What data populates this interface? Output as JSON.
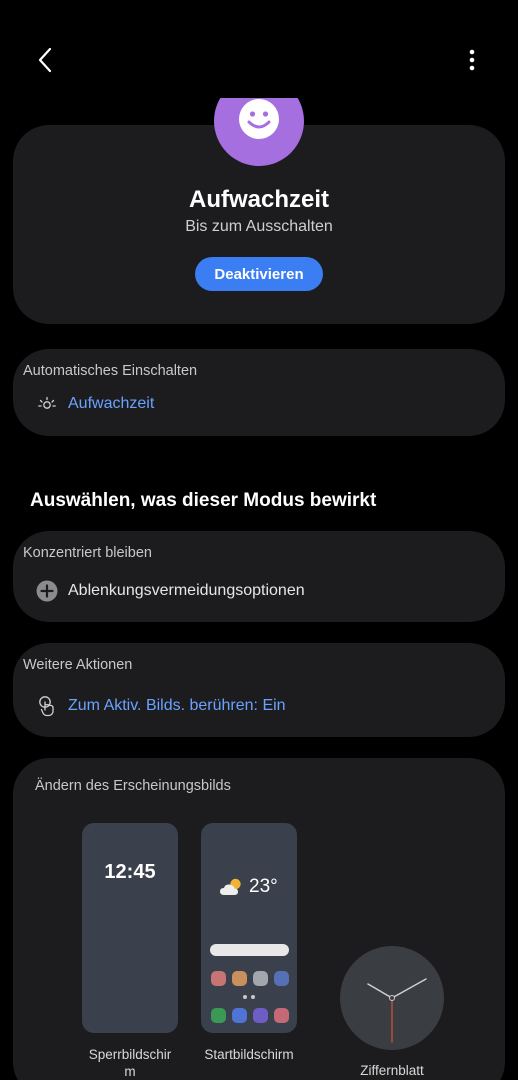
{
  "mode": {
    "title": "Aufwachzeit",
    "subtitle": "Bis zum Ausschalten",
    "deactivate_label": "Deaktivieren",
    "icon": "smiley-face-icon",
    "icon_color": "#a56fe0"
  },
  "auto_on": {
    "label": "Automatisches Einschalten",
    "item_label": "Aufwachzeit",
    "item_icon": "sunrise-icon"
  },
  "section_heading": "Auswählen, was dieser Modus bewirkt",
  "focus": {
    "label": "Konzentriert bleiben",
    "item_label": "Ablenkungsvermeidungsoptionen",
    "item_icon": "add-circle-icon"
  },
  "more_actions": {
    "label": "Weitere Aktionen",
    "item_label": "Zum Aktiv. Bilds. berühren: Ein",
    "item_icon": "touch-icon"
  },
  "appearance": {
    "label": "Ändern des Erscheinungsbilds",
    "lock_time": "12:45",
    "home_temp": "23°",
    "lock_label_line1": "Sperrbildschir",
    "lock_label_line2": "m",
    "home_label": "Startbildschirm",
    "watch_label": "Ziffernblatt"
  },
  "colors": {
    "accent": "#3b7df2",
    "link": "#6aa2ff",
    "card": "#1c1c1e"
  }
}
